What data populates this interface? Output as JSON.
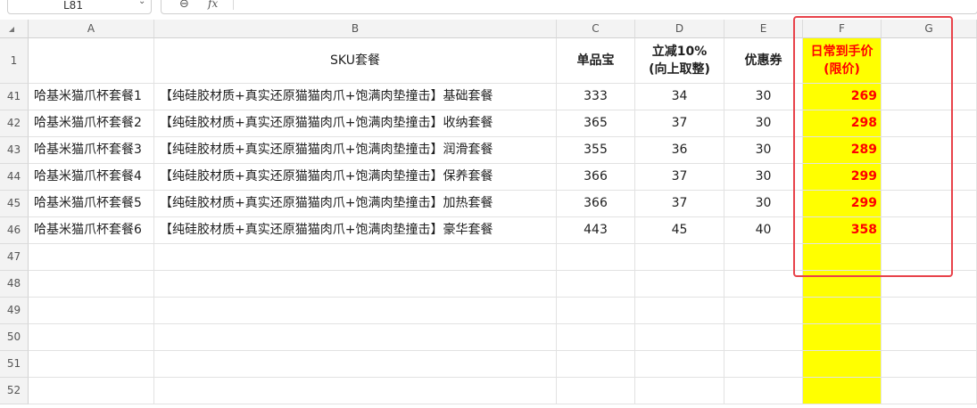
{
  "toolbar": {
    "name_box": "L81",
    "formula_icon": "fx"
  },
  "columns": [
    "A",
    "B",
    "C",
    "D",
    "E",
    "F",
    "G"
  ],
  "header_row": {
    "row_number": "1",
    "A": "",
    "B": "SKU套餐",
    "C": "单品宝",
    "D_line1": "立减10%",
    "D_line2": "(向上取整)",
    "E": "优惠券",
    "F_line1": "日常到手价",
    "F_line2": "(限价)"
  },
  "rows": [
    {
      "row": "41",
      "A": "哈基米猫爪杯套餐1",
      "B": "【纯硅胶材质+真实还原猫猫肉爪+饱满肉垫撞击】基础套餐",
      "C": "333",
      "D": "34",
      "E": "30",
      "F": "269"
    },
    {
      "row": "42",
      "A": "哈基米猫爪杯套餐2",
      "B": "【纯硅胶材质+真实还原猫猫肉爪+饱满肉垫撞击】收纳套餐",
      "C": "365",
      "D": "37",
      "E": "30",
      "F": "298"
    },
    {
      "row": "43",
      "A": "哈基米猫爪杯套餐3",
      "B": "【纯硅胶材质+真实还原猫猫肉爪+饱满肉垫撞击】润滑套餐",
      "C": "355",
      "D": "36",
      "E": "30",
      "F": "289"
    },
    {
      "row": "44",
      "A": "哈基米猫爪杯套餐4",
      "B": "【纯硅胶材质+真实还原猫猫肉爪+饱满肉垫撞击】保养套餐",
      "C": "366",
      "D": "37",
      "E": "30",
      "F": "299"
    },
    {
      "row": "45",
      "A": "哈基米猫爪杯套餐5",
      "B": "【纯硅胶材质+真实还原猫猫肉爪+饱满肉垫撞击】加热套餐",
      "C": "366",
      "D": "37",
      "E": "30",
      "F": "299"
    },
    {
      "row": "46",
      "A": "哈基米猫爪杯套餐6",
      "B": "【纯硅胶材质+真实还原猫猫肉爪+饱满肉垫撞击】豪华套餐",
      "C": "443",
      "D": "45",
      "E": "40",
      "F": "358"
    }
  ],
  "empty_rows": [
    "47",
    "48",
    "49",
    "50",
    "51",
    "52"
  ],
  "colors": {
    "highlight_fill": "#ffff00",
    "price_text": "#ff0000",
    "annotation_box": "#e8424a"
  }
}
